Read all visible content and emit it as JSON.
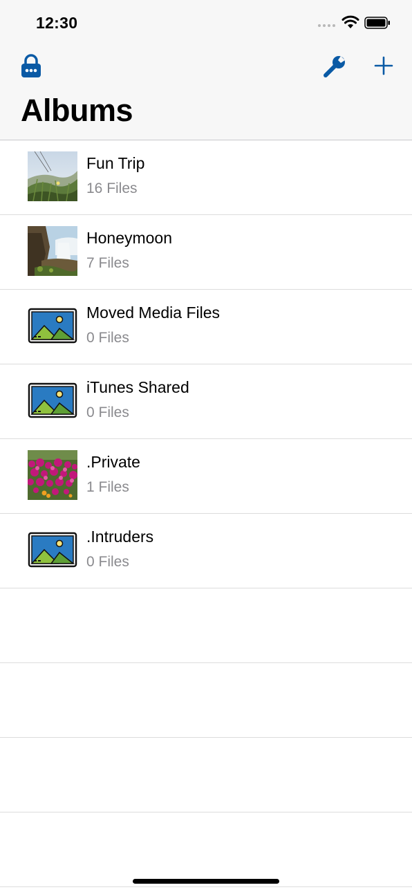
{
  "status_bar": {
    "time": "12:30"
  },
  "header": {
    "title": "Albums"
  },
  "toolbar": {
    "lock_icon": "lock-icon",
    "settings_icon": "wrench-icon",
    "add_icon": "plus-icon",
    "accent_color": "#0a5aa5"
  },
  "albums": [
    {
      "name": "Fun Trip",
      "count": "16 Files",
      "thumb": "photo-grass"
    },
    {
      "name": "Honeymoon",
      "count": "7 Files",
      "thumb": "photo-waterfall"
    },
    {
      "name": "Moved Media Files",
      "count": "0 Files",
      "thumb": "placeholder-image-icon"
    },
    {
      "name": "iTunes Shared",
      "count": "0 Files",
      "thumb": "placeholder-image-icon"
    },
    {
      "name": ".Private",
      "count": "1 Files",
      "thumb": "photo-flowers"
    },
    {
      "name": ".Intruders",
      "count": "0 Files",
      "thumb": "placeholder-image-icon"
    }
  ]
}
